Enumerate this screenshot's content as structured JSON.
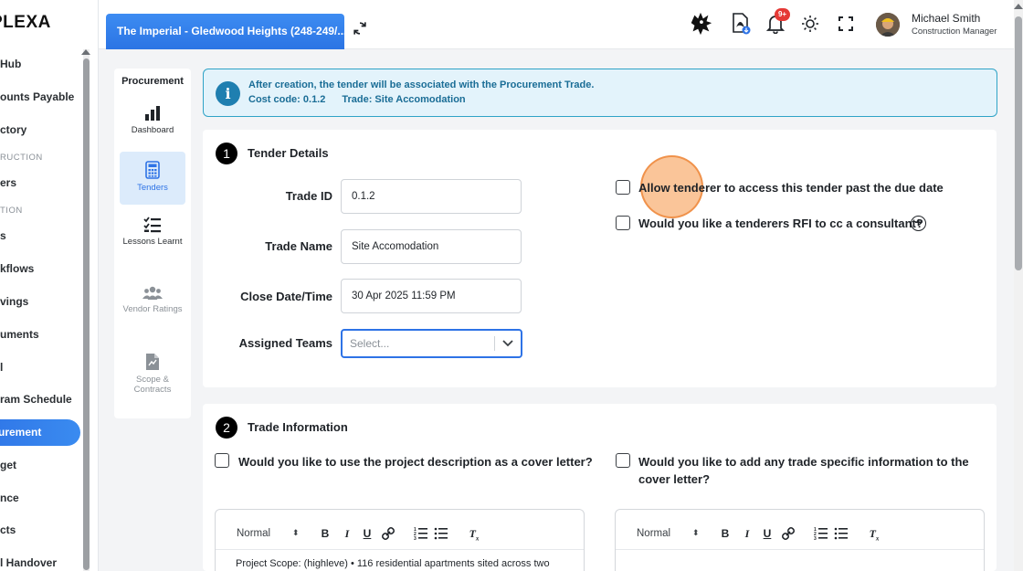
{
  "app": {
    "logo_text": "PLEXA",
    "project_tab": "The Imperial - Gledwood Heights (248-249/...",
    "notifications_count": "9+"
  },
  "user": {
    "name": "Michael Smith",
    "role": "Construction Manager"
  },
  "sidebar": {
    "items": [
      {
        "label": "Hub"
      },
      {
        "label": "ounts Payable"
      },
      {
        "label": "ctory"
      },
      {
        "label": "RUCTION"
      },
      {
        "label": "ers"
      },
      {
        "label": "TION"
      },
      {
        "label": "s"
      },
      {
        "label": "kflows"
      },
      {
        "label": "vings"
      },
      {
        "label": "uments"
      },
      {
        "label": "l"
      },
      {
        "label": "ram Schedule"
      },
      {
        "label": "urement"
      },
      {
        "label": "get"
      },
      {
        "label": "nce"
      },
      {
        "label": "cts"
      },
      {
        "label": "l Handover"
      }
    ]
  },
  "procurement_nav": {
    "title": "Procurement",
    "items": [
      {
        "label": "Dashboard"
      },
      {
        "label": "Tenders"
      },
      {
        "label": "Lessons Learnt"
      },
      {
        "label": "Vendor Ratings"
      },
      {
        "label": "Scope & Contracts"
      }
    ]
  },
  "info_banner": {
    "line1": "After creation, the tender will be associated with the Procurement Trade.",
    "cost_code": "Cost code: 0.1.2",
    "trade": "Trade: Site Accomodation"
  },
  "tender_details": {
    "step": "1",
    "title": "Tender Details",
    "trade_id_label": "Trade ID",
    "trade_id_value": "0.1.2",
    "trade_name_label": "Trade Name",
    "trade_name_value": "Site Accomodation",
    "close_label": "Close Date/Time",
    "close_value": "30 Apr 2025 11:59 PM",
    "teams_label": "Assigned Teams",
    "teams_placeholder": "Select...",
    "allow_past_due": "Allow tenderer to access this tender past the due date",
    "rfi_cc": "Would you like a tenderers RFI to cc a consultant?"
  },
  "trade_information": {
    "step": "2",
    "title": "Trade Information",
    "use_description": "Would you like to use the project description as a cover letter?",
    "add_specific": "Would you like to add any trade specific information to the cover letter?",
    "editor_format": "Normal",
    "editor_left_text": "Project Scope: (highleve) • 116 residential apartments sited across two"
  }
}
